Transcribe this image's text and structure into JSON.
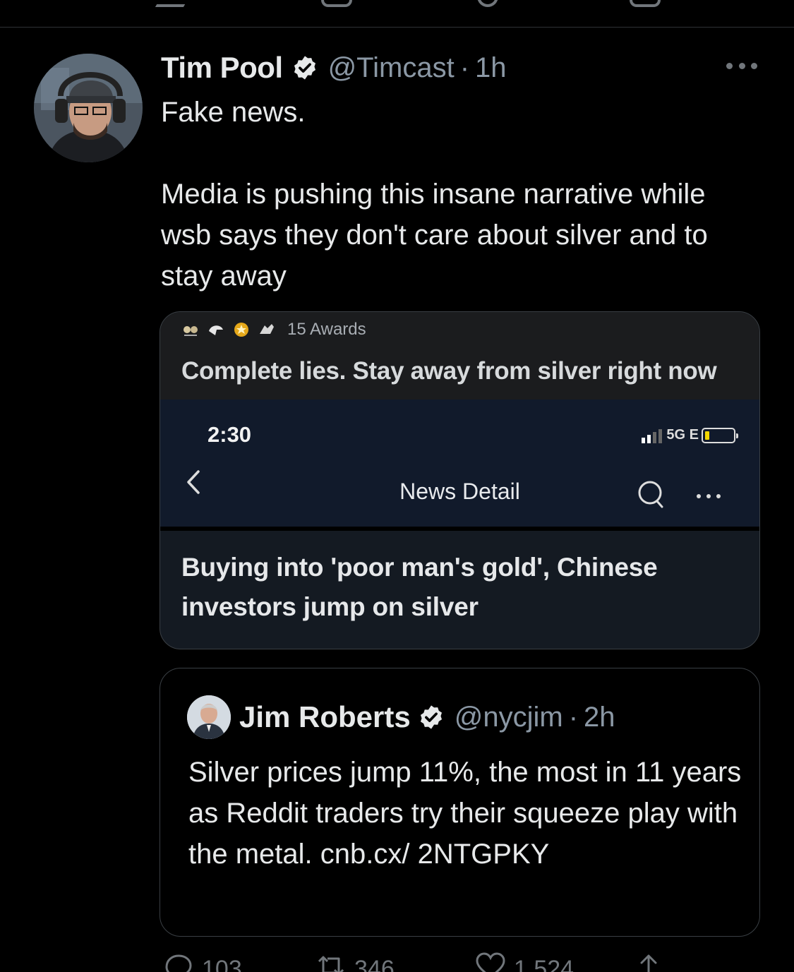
{
  "tweet": {
    "author_name": "Tim Pool",
    "handle": "@Timcast",
    "separator": "·",
    "time": "1h",
    "text": "Fake news.\n\nMedia is pushing this insane narrative while wsb says they don't care about silver and to stay away"
  },
  "media": {
    "awards_label": "15 Awards",
    "post_title": "Complete lies. Stay away from silver right now",
    "phone_time": "2:30",
    "network": "5G E",
    "nav_title": "News Detail",
    "headline": "Buying into 'poor man's gold', Chinese investors jump on silver"
  },
  "quoted_tweet": {
    "author_name": "Jim Roberts",
    "handle": "@nycjim",
    "separator": "·",
    "time": "2h",
    "text": "Silver prices jump 11%, the most in 11 years as Reddit traders try their squeeze play with the metal. cnb.cx/ 2NTGPKY"
  },
  "actions": {
    "replies": "103",
    "retweets": "346",
    "likes": "1,524"
  },
  "colors": {
    "background": "#000000",
    "text": "#e7e9ea",
    "secondary": "#8b98a5",
    "border": "#3a3f44",
    "verified_badge": "#e7e9ea"
  },
  "icons": [
    "more-icon",
    "verified-badge-icon",
    "back-chevron-icon",
    "search-icon",
    "reply-icon",
    "retweet-icon",
    "like-icon",
    "share-icon"
  ]
}
